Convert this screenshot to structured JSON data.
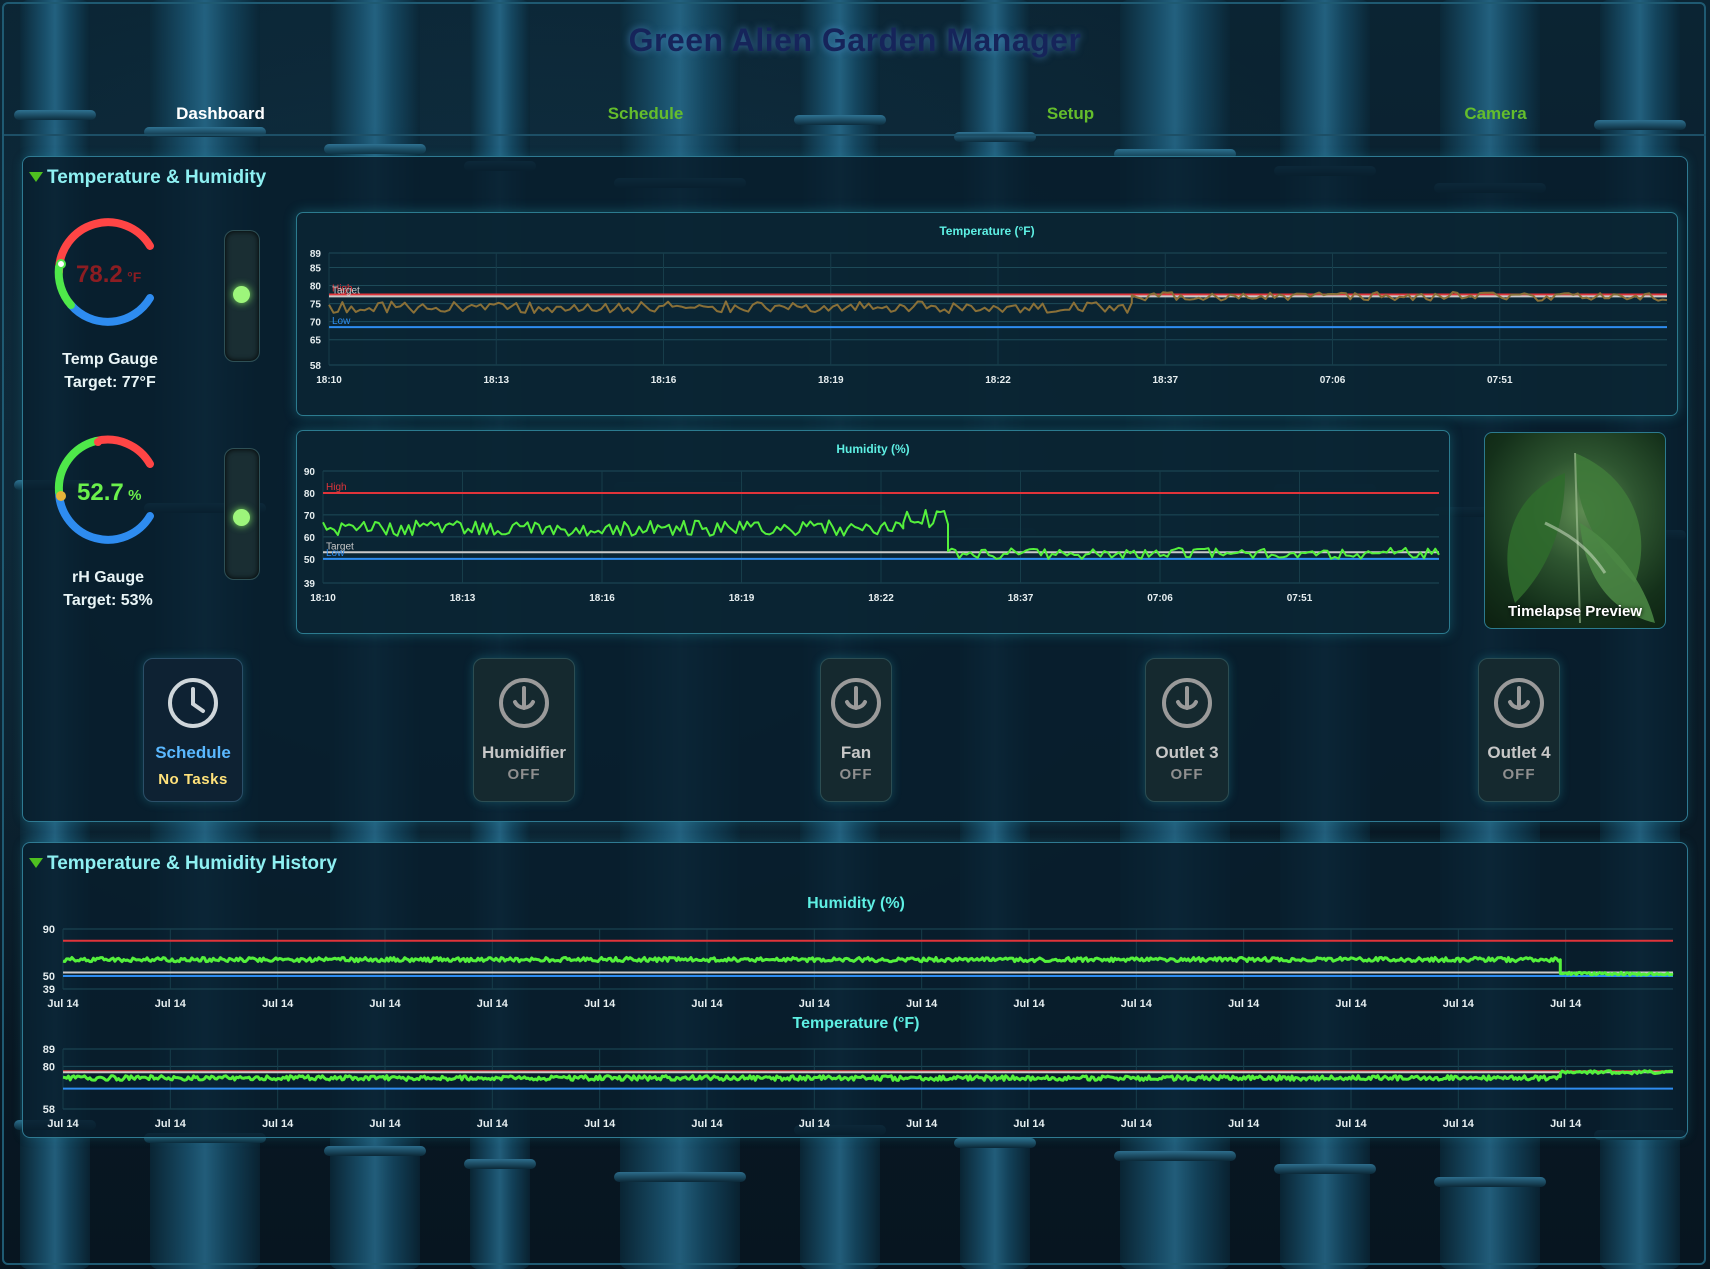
{
  "app": {
    "title": "Green Alien Garden Manager"
  },
  "nav": {
    "tabs": [
      "Dashboard",
      "Schedule",
      "Setup",
      "Camera"
    ],
    "active": "Dashboard"
  },
  "colors": {
    "accent_green": "#64bd2c",
    "title_cyan": "#8ef0f2",
    "high_red": "#e0343a",
    "low_blue": "#2e8cf0",
    "series_green": "#54f03c",
    "series_olive": "#8a7038"
  },
  "section_main": {
    "title": "Temperature & Humidity"
  },
  "temp_gauge": {
    "value": "78.2",
    "unit": "°F",
    "label": "Temp Gauge",
    "target": "Target: 77°F",
    "value_color": "#8c1d22"
  },
  "rh_gauge": {
    "value": "52.7",
    "unit": "%",
    "label": "rH Gauge",
    "target": "Target: 53%",
    "value_color": "#6bf04c"
  },
  "preview": {
    "label": "Timelapse Preview"
  },
  "controls": [
    {
      "name": "Schedule",
      "state": "No Tasks",
      "icon": "clock-icon"
    },
    {
      "name": "Humidifier",
      "state": "OFF",
      "icon": "power-icon"
    },
    {
      "name": "Fan",
      "state": "OFF",
      "icon": "power-icon"
    },
    {
      "name": "Outlet 3",
      "state": "OFF",
      "icon": "power-icon"
    },
    {
      "name": "Outlet 4",
      "state": "OFF",
      "icon": "power-icon"
    }
  ],
  "section_history": {
    "title": "Temperature & Humidity History"
  },
  "chart_data": [
    {
      "id": "temp_live",
      "type": "line",
      "title": "Temperature (°F)",
      "yticks": [
        58,
        65,
        70,
        75,
        80,
        85,
        89
      ],
      "ylim": [
        58,
        89
      ],
      "xticks": [
        "18:10",
        "18:13",
        "18:16",
        "18:19",
        "18:22",
        "18:37",
        "07:06",
        "07:51"
      ],
      "lines": [
        {
          "name": "High",
          "value": 77.5
        },
        {
          "name": "Target",
          "value": 77
        },
        {
          "name": "Low",
          "value": 68.5
        }
      ],
      "series": [
        {
          "segments": [
            {
              "x": [
                0,
                0.6
              ],
              "mean": 74,
              "amp": 1.6
            },
            {
              "x": [
                0.6,
                1
              ],
              "mean": 77,
              "amp": 1.2
            }
          ]
        }
      ]
    },
    {
      "id": "hum_live",
      "type": "line",
      "title": "Humidity (%)",
      "yticks": [
        39,
        50,
        60,
        70,
        80,
        90
      ],
      "ylim": [
        39,
        90
      ],
      "xticks": [
        "18:10",
        "18:13",
        "18:16",
        "18:19",
        "18:22",
        "18:37",
        "07:06",
        "07:51"
      ],
      "lines": [
        {
          "name": "High",
          "value": 80
        },
        {
          "name": "Target",
          "value": 53
        },
        {
          "name": "Low",
          "value": 50
        }
      ],
      "series": [
        {
          "segments": [
            {
              "x": [
                0,
                0.52
              ],
              "mean": 64,
              "amp": 3.5
            },
            {
              "x": [
                0.52,
                0.56
              ],
              "mean": 68,
              "amp": 5
            },
            {
              "x": [
                0.56,
                1
              ],
              "mean": 52.5,
              "amp": 2.5
            }
          ]
        }
      ]
    },
    {
      "id": "hum_history",
      "type": "line",
      "title": "Humidity (%)",
      "yticks": [
        39,
        50,
        90
      ],
      "ylim": [
        39,
        90
      ],
      "xticks": [
        "Jul 14",
        "Jul 14",
        "Jul 14",
        "Jul 14",
        "Jul 14",
        "Jul 14",
        "Jul 14",
        "Jul 14",
        "Jul 14",
        "Jul 14",
        "Jul 14",
        "Jul 14",
        "Jul 14",
        "Jul 14",
        "Jul 14"
      ],
      "lines": [
        {
          "name": "High",
          "value": 80
        },
        {
          "name": "Target",
          "value": 53
        },
        {
          "name": "Low",
          "value": 50
        }
      ],
      "series": [
        {
          "segments": [
            {
              "x": [
                0,
                0.93
              ],
              "mean": 64,
              "amp": 1.8
            },
            {
              "x": [
                0.93,
                1
              ],
              "mean": 52,
              "amp": 1.2
            }
          ]
        }
      ]
    },
    {
      "id": "temp_history",
      "type": "line",
      "title": "Temperature (°F)",
      "yticks": [
        58,
        80,
        89
      ],
      "ylim": [
        58,
        89
      ],
      "xticks": [
        "Jul 14",
        "Jul 14",
        "Jul 14",
        "Jul 14",
        "Jul 14",
        "Jul 14",
        "Jul 14",
        "Jul 14",
        "Jul 14",
        "Jul 14",
        "Jul 14",
        "Jul 14",
        "Jul 14",
        "Jul 14",
        "Jul 14"
      ],
      "lines": [
        {
          "name": "High",
          "value": 77.5
        },
        {
          "name": "Target",
          "value": 77
        },
        {
          "name": "Low",
          "value": 68.5
        }
      ],
      "series": [
        {
          "segments": [
            {
              "x": [
                0,
                0.93
              ],
              "mean": 74,
              "amp": 1.2
            },
            {
              "x": [
                0.93,
                1
              ],
              "mean": 77,
              "amp": 0.8
            }
          ]
        }
      ]
    }
  ]
}
